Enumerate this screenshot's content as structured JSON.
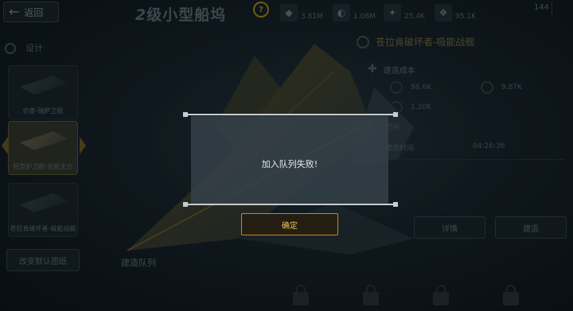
{
  "header": {
    "back_label": "返回",
    "title_num": "2",
    "title_text": "级小型船坞",
    "resources": [
      {
        "icon": "crystal-resource-icon",
        "value": "3.81M"
      },
      {
        "icon": "metal-resource-icon",
        "value": "1.08M"
      },
      {
        "icon": "energy-resource-icon",
        "value": "25.4K"
      },
      {
        "icon": "gem-resource-icon",
        "value": "95.1K"
      }
    ],
    "corner_value": "144"
  },
  "left_panel": {
    "section_label": "设计",
    "cards": [
      {
        "name": "侦查-瑞萨卫舰"
      },
      {
        "name": "轻型护卫舰-巡航主力"
      },
      {
        "name": "苍拉肯破坏者-吸能战舰"
      }
    ],
    "default_button": "改变默认图纸"
  },
  "right_panel": {
    "ship_name": "苍拉肯破坏者-吸能战舰",
    "cost_label": "建造成本",
    "costs": [
      {
        "value": "98.6K"
      },
      {
        "value": "9.87K"
      },
      {
        "value": "1.20K"
      }
    ],
    "build_time_label": "建造时间",
    "build_time_value": "04:26:36",
    "time_section_label": "时间",
    "details_button": "详情",
    "build_button": "建造"
  },
  "queue": {
    "label": "建造队列"
  },
  "dialog": {
    "message": "加入队列失败!",
    "confirm_label": "确定"
  },
  "colors": {
    "accent": "#c58a20",
    "background": "#0f1820"
  }
}
